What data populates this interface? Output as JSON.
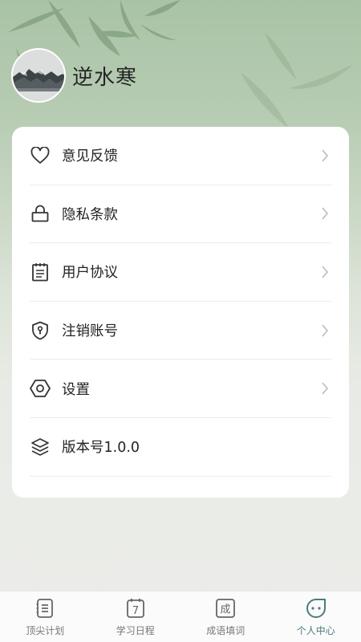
{
  "profile": {
    "username": "逆水寒"
  },
  "menu": {
    "items": [
      {
        "label": "意见反馈",
        "icon": "heart-icon"
      },
      {
        "label": "隐私条款",
        "icon": "lock-icon"
      },
      {
        "label": "用户协议",
        "icon": "document-icon"
      },
      {
        "label": "注销账号",
        "icon": "shield-icon"
      },
      {
        "label": "设置",
        "icon": "hexagon-settings-icon"
      },
      {
        "label": "版本号1.0.0",
        "icon": "layers-icon"
      }
    ]
  },
  "tabbar": {
    "tabs": [
      {
        "label": "顶尖计划",
        "icon": "list-icon",
        "active": false
      },
      {
        "label": "学习日程",
        "icon": "calendar-icon",
        "icon_text": "7",
        "active": false
      },
      {
        "label": "成语填词",
        "icon": "idiom-icon",
        "icon_text": "成",
        "active": false
      },
      {
        "label": "个人中心",
        "icon": "profile-face-icon",
        "active": true
      }
    ]
  },
  "colors": {
    "accent": "#4e7a7f",
    "text": "#222222",
    "tab_inactive": "#777777"
  }
}
